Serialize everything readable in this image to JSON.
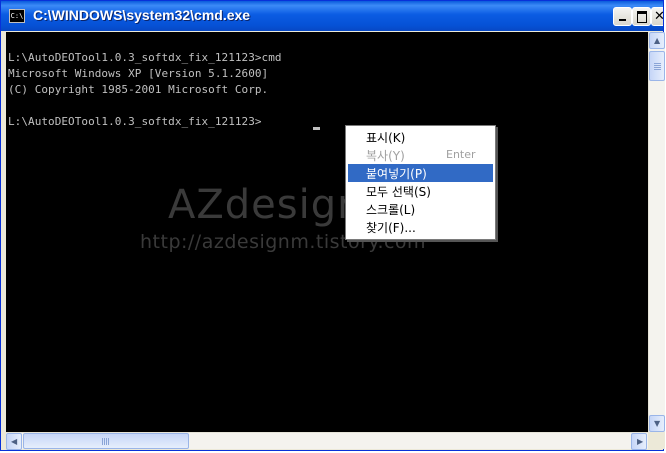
{
  "window": {
    "title": "C:\\WINDOWS\\system32\\cmd.exe",
    "icon_label": "C:\\",
    "accent_color": "#0a5bdc",
    "buttons": {
      "minimize": "minimize-icon",
      "maximize": "maximize-icon",
      "close": "close-icon"
    }
  },
  "console": {
    "background": "#000000",
    "text_color": "#c0c0c0",
    "lines": [
      "L:\\AutoDEOTool1.0.3_softdx_fix_121123>cmd",
      "Microsoft Windows XP [Version 5.1.2600]",
      "(C) Copyright 1985-2001 Microsoft Corp.",
      "",
      "L:\\AutoDEOTool1.0.3_softdx_fix_121123>"
    ]
  },
  "watermark": {
    "title": "AZdesignM",
    "url": "http://azdesignm.tistory.com"
  },
  "context_menu": {
    "items": [
      {
        "label": "표시(K)",
        "shortcut": "",
        "state": "normal"
      },
      {
        "label": "복사(Y)",
        "shortcut": "Enter",
        "state": "disabled"
      },
      {
        "label": "붙여넣기(P)",
        "shortcut": "",
        "state": "highlighted"
      },
      {
        "label": "모두 선택(S)",
        "shortcut": "",
        "state": "normal"
      },
      {
        "label": "스크롤(L)",
        "shortcut": "",
        "state": "normal"
      },
      {
        "label": "찾기(F)...",
        "shortcut": "",
        "state": "normal"
      }
    ],
    "highlight_color": "#316ac5"
  },
  "scrollbars": {
    "vertical": {
      "position": 0
    },
    "horizontal": {
      "position": 0
    }
  }
}
